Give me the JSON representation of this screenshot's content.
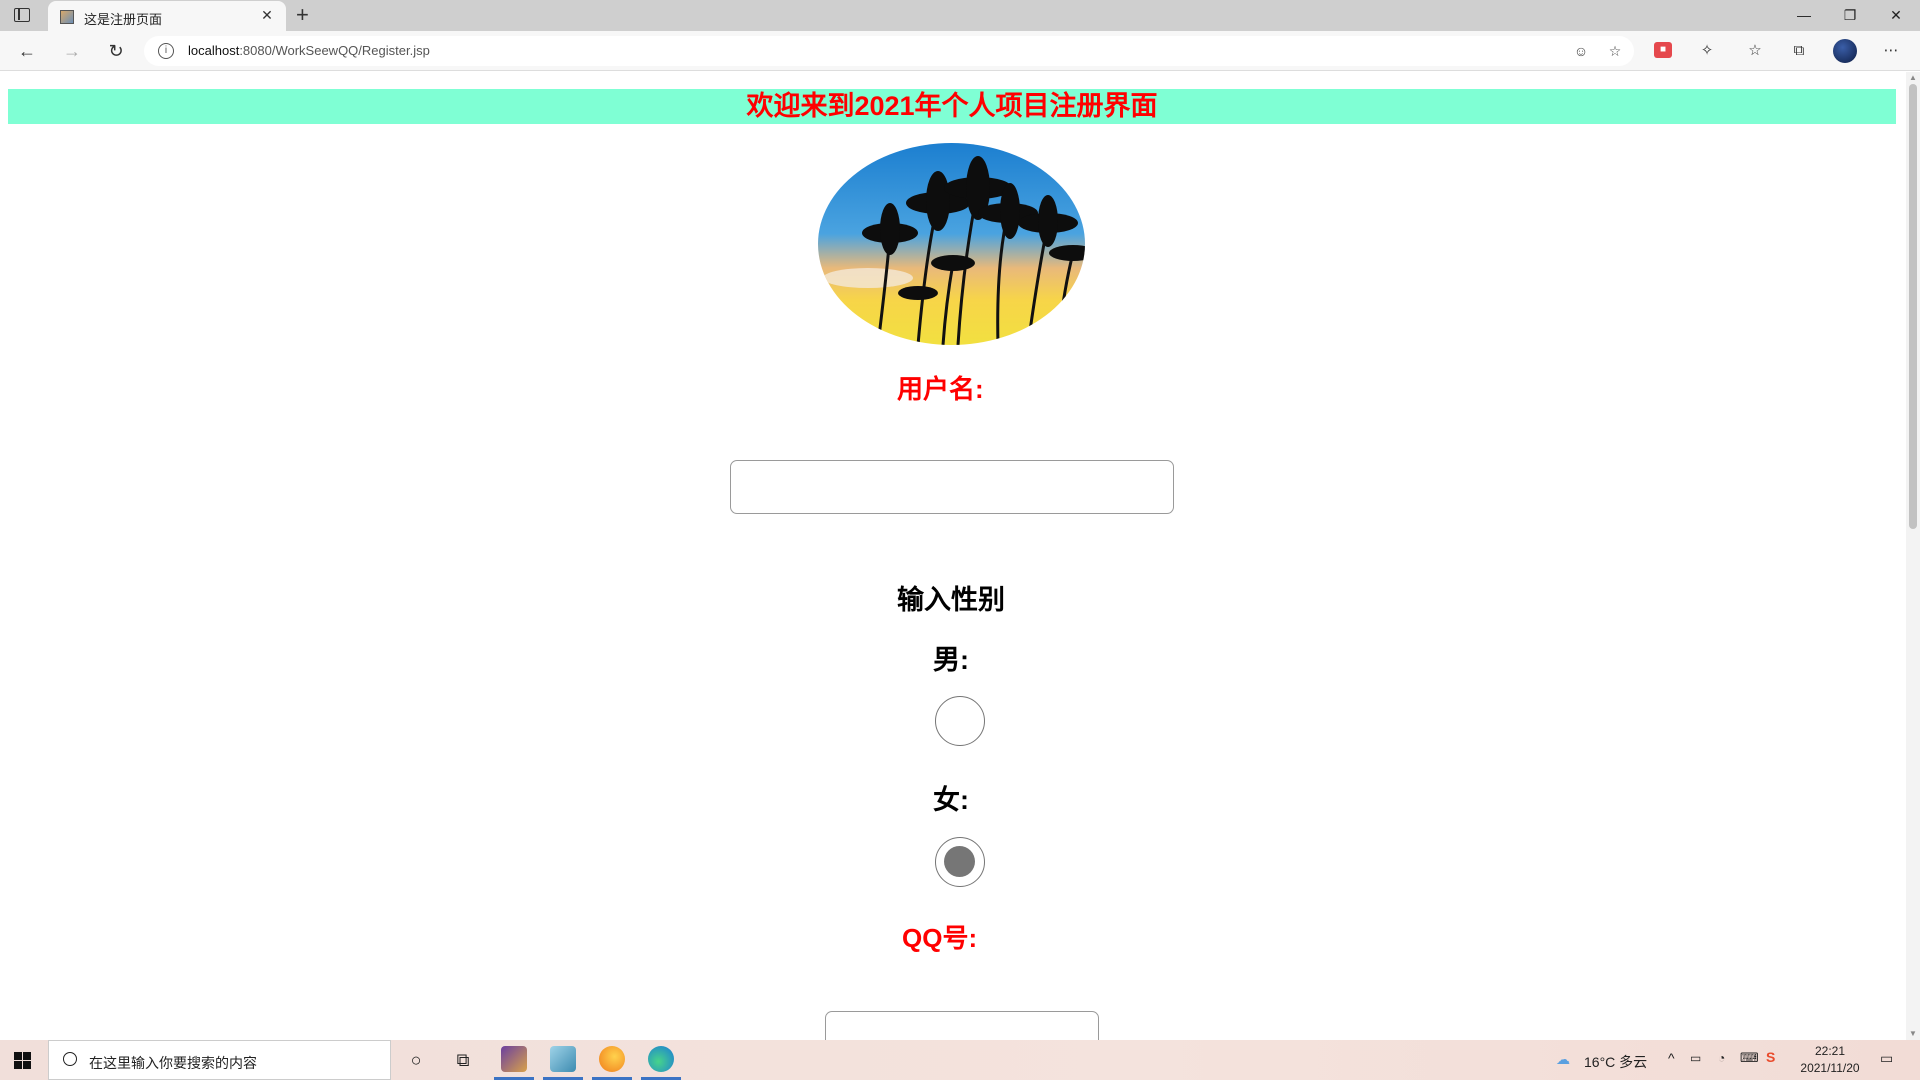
{
  "browser": {
    "tab_title": "这是注册页面",
    "url_host": "localhost",
    "url_rest": ":8080/WorkSeewQQ/Register.jsp",
    "icons": [
      "tab-strip-icon",
      "new-tab-icon",
      "back-icon",
      "forward-icon",
      "refresh-icon",
      "info-icon",
      "tracking-icon",
      "add-favorite-icon",
      "extension-icon",
      "puzzle-icon",
      "favorites-icon",
      "collections-icon",
      "more-icon"
    ]
  },
  "page": {
    "banner_text": "欢迎来到2021年个人项目注册界面",
    "username_label": "用户名:",
    "username_value": "",
    "gender_heading": "输入性别",
    "male_label": "男:",
    "female_label": "女:",
    "male_checked": false,
    "female_checked": true,
    "qq_label": "QQ号:",
    "qq_value": "",
    "colors": {
      "banner_bg": "#7fffd4",
      "accent_red": "#ff0000"
    }
  },
  "taskbar": {
    "search_placeholder": "在这里输入你要搜索的内容",
    "weather": "16°C 多云",
    "time": "22:21",
    "date": "2021/11/20"
  }
}
